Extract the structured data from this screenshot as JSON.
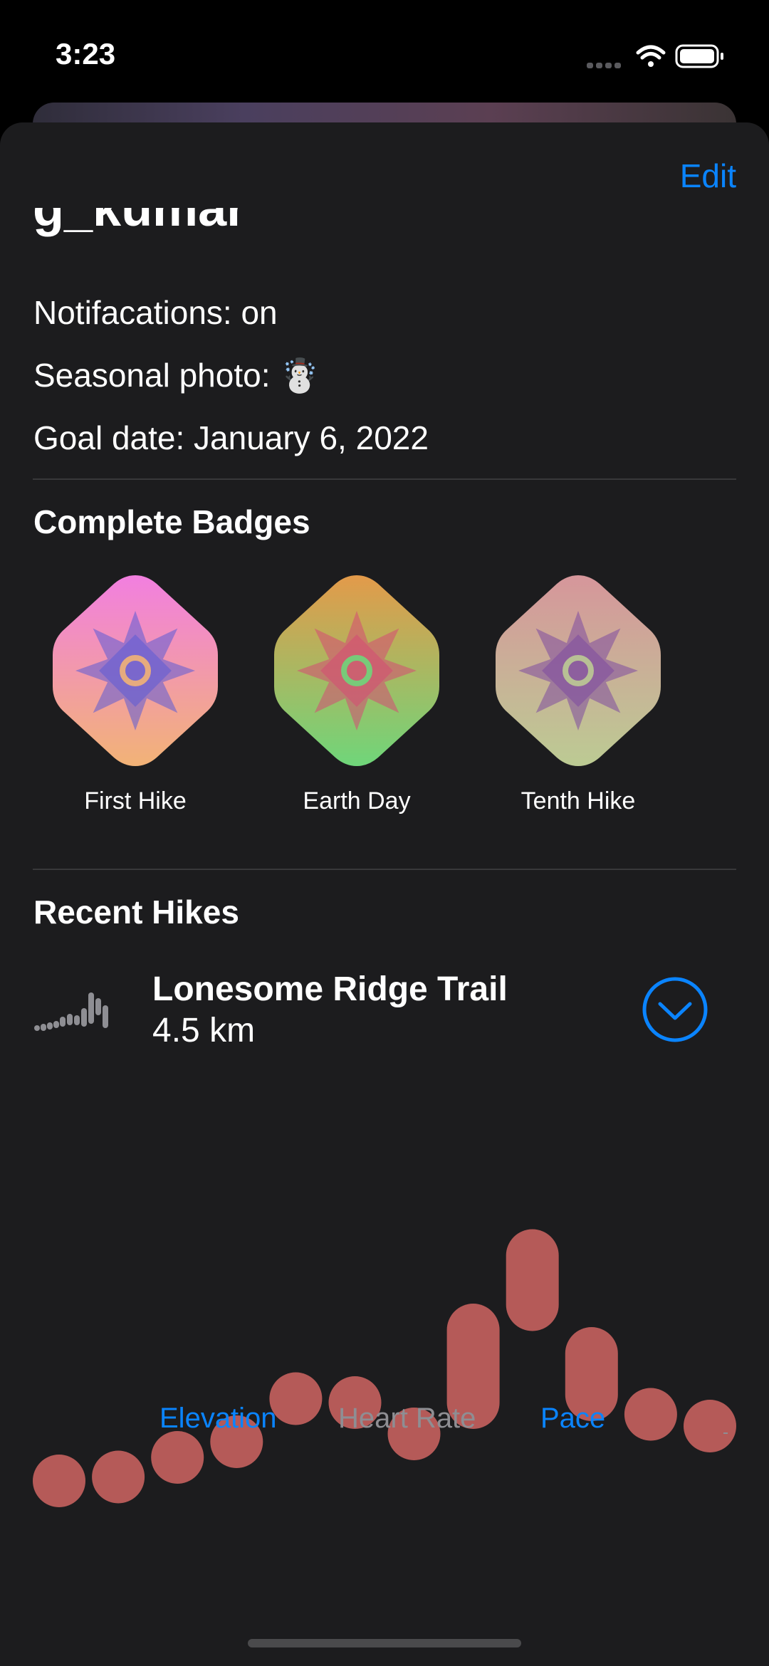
{
  "status_bar": {
    "time": "3:23"
  },
  "sheet": {
    "edit_label": "Edit"
  },
  "profile": {
    "username": "g_kumar",
    "notifications": "Notifacations: on",
    "seasonal_photo": "Seasonal photo: ☃️",
    "goal_date": "Goal date: January 6, 2022"
  },
  "badges": {
    "title": "Complete Badges",
    "items": [
      {
        "label": "First Hike",
        "colors": [
          "#f27fe0",
          "#f2b376"
        ],
        "star": "#5b5bd6"
      },
      {
        "label": "Earth Day",
        "colors": [
          "#e39a4a",
          "#6fd67a"
        ],
        "star": "#d64a74"
      },
      {
        "label": "Tenth Hike",
        "colors": [
          "#d6969b",
          "#bccb93"
        ],
        "star": "#7d4aa0"
      }
    ]
  },
  "recent_hikes": {
    "title": "Recent Hikes",
    "hike": {
      "name": "Lonesome Ridge Trail",
      "distance": "4.5 km"
    }
  },
  "chart_data": {
    "type": "bar",
    "series": [
      {
        "values": [
          [
            0.0,
            0.1
          ],
          [
            0.01,
            0.12
          ],
          [
            0.06,
            0.16
          ],
          [
            0.1,
            0.21
          ],
          [
            0.21,
            0.33
          ],
          [
            0.2,
            0.29
          ],
          [
            0.12,
            0.21
          ],
          [
            0.2,
            0.52
          ],
          [
            0.45,
            0.71
          ],
          [
            0.22,
            0.46
          ],
          [
            0.17,
            0.28
          ],
          [
            0.14,
            0.24
          ]
        ]
      }
    ],
    "bar_color": "#b55a58"
  },
  "tabs": {
    "items": [
      {
        "label": "Elevation",
        "state": "active"
      },
      {
        "label": "Heart Rate",
        "state": "inactive"
      },
      {
        "label": "Pace",
        "state": "active"
      }
    ]
  },
  "colors": {
    "accent": "#0a84ff",
    "sheet_bg": "#1c1c1e"
  }
}
